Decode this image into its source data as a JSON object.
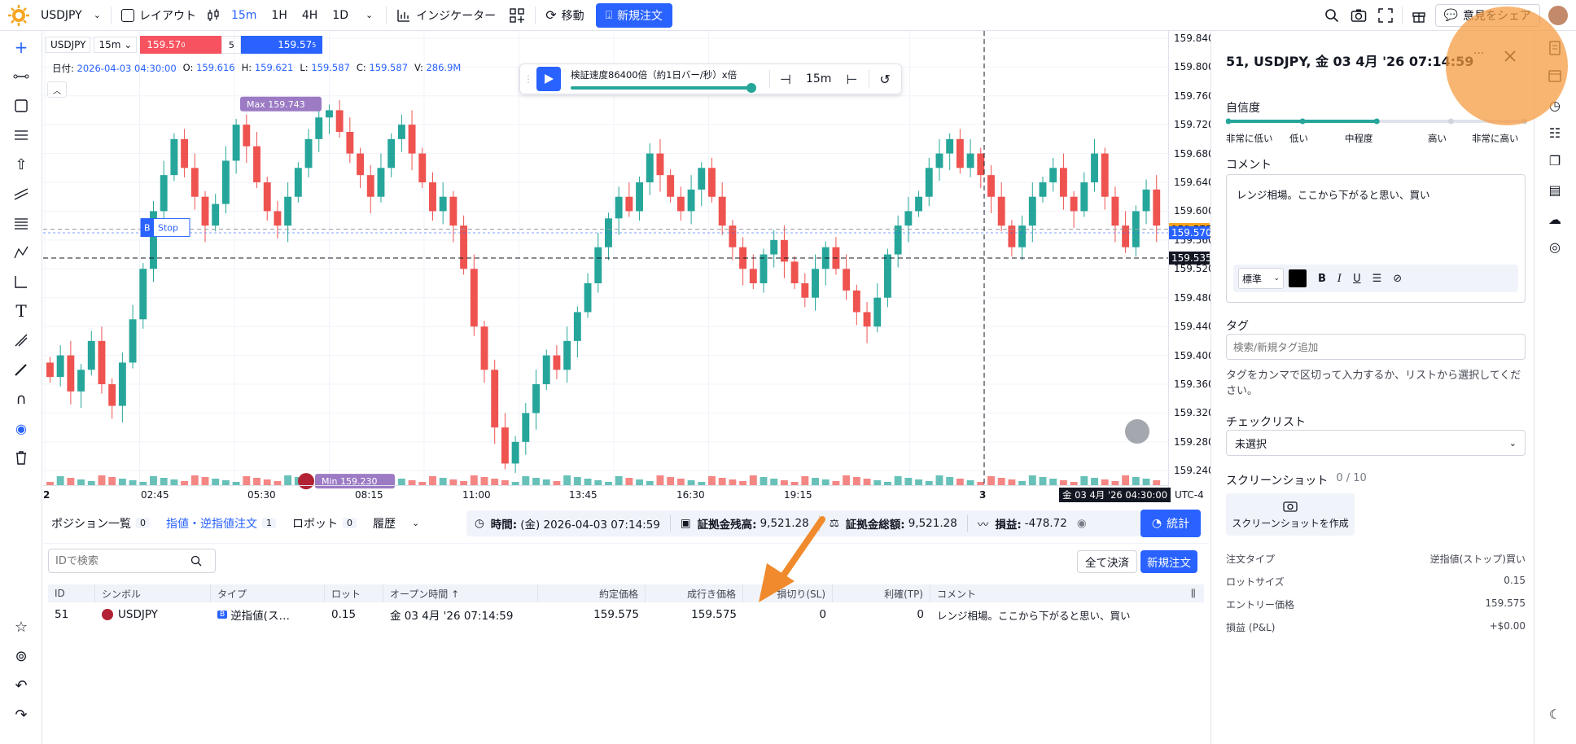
{
  "topbar": {
    "symbol": "USDJPY",
    "layout_label": "レイアウト",
    "timeframes": [
      "15m",
      "1H",
      "4H",
      "1D"
    ],
    "indicators_label": "インジケーター",
    "move_label": "移動",
    "new_order_label": "新規注文",
    "feedback_label": "意見をシェア"
  },
  "legend": {
    "symbol": "USDJPY",
    "interval": "15m",
    "bid": "159.57",
    "bid_sup": "0",
    "spread": "5",
    "ask": "159.57",
    "ask_sup": "5",
    "date_label": "日付:",
    "date": "2026-04-03 04:30:00",
    "o_label": "O:",
    "o": "159.616",
    "h_label": "H:",
    "h": "159.621",
    "l_label": "L:",
    "l": "159.587",
    "c_label": "C:",
    "c": "159.587",
    "v_label": "V:",
    "v": "286.9M"
  },
  "replay": {
    "speed_label": "検証速度86400倍（約1日バー/秒）x倍",
    "interval": "15m",
    "progress": 1.0
  },
  "chart_data": {
    "type": "candlestick",
    "y_ticks": [
      "159.840",
      "159.800",
      "159.760",
      "159.720",
      "159.680",
      "159.640",
      "159.600",
      "159.560",
      "159.520",
      "159.480",
      "159.440",
      "159.400",
      "159.360",
      "159.320",
      "159.280",
      "159.240"
    ],
    "ylim": [
      159.22,
      159.85
    ],
    "x_ticks": [
      "2",
      "02:45",
      "05:30",
      "08:15",
      "11:00",
      "13:45",
      "16:30",
      "19:15",
      "3"
    ],
    "max_label": "Max",
    "max_value": "159.743",
    "min_label": "Min",
    "min_value": "159.230",
    "stop_label": "Stop",
    "stop_side": "B",
    "price_labels": {
      "a": "159.575",
      "b": "159.570",
      "c": "159.535"
    },
    "crosshair_time": "金 03 4月 '26 04:30:00",
    "timezone": "UTC-4",
    "colors": {
      "up": "#26a69a",
      "down": "#ef5350"
    },
    "close_prices": [
      159.37,
      159.4,
      159.35,
      159.38,
      159.42,
      159.36,
      159.33,
      159.39,
      159.45,
      159.52,
      159.6,
      159.65,
      159.7,
      159.66,
      159.62,
      159.58,
      159.61,
      159.67,
      159.72,
      159.69,
      159.64,
      159.6,
      159.58,
      159.62,
      159.66,
      159.7,
      159.73,
      159.74,
      159.71,
      159.68,
      159.65,
      159.62,
      159.66,
      159.7,
      159.72,
      159.68,
      159.64,
      159.6,
      159.62,
      159.58,
      159.52,
      159.44,
      159.38,
      159.3,
      159.25,
      159.28,
      159.32,
      159.36,
      159.4,
      159.38,
      159.42,
      159.46,
      159.5,
      159.55,
      159.59,
      159.62,
      159.6,
      159.64,
      159.68,
      159.65,
      159.62,
      159.6,
      159.63,
      159.66,
      159.62,
      159.58,
      159.55,
      159.52,
      159.5,
      159.54,
      159.56,
      159.53,
      159.5,
      159.48,
      159.52,
      159.55,
      159.52,
      159.49,
      159.46,
      159.44,
      159.48,
      159.54,
      159.58,
      159.6,
      159.62,
      159.66,
      159.68,
      159.7,
      159.66,
      159.68,
      159.65,
      159.62,
      159.58,
      159.55,
      159.58,
      159.62,
      159.64,
      159.66,
      159.62,
      159.6,
      159.64,
      159.68,
      159.62,
      159.58,
      159.55,
      159.6,
      159.63,
      159.58
    ]
  },
  "bottom": {
    "tabs": [
      {
        "label": "ポジション一覧",
        "count": "0"
      },
      {
        "label": "指値・逆指値注文",
        "count": "1"
      },
      {
        "label": "ロボット",
        "count": "0"
      },
      {
        "label": "履歴",
        "count": ""
      }
    ],
    "time_label": "時間:",
    "time_value": "(金) 2026-04-03 07:14:59",
    "balance_label": "証拠金残高:",
    "balance_value": "9,521.28",
    "equity_label": "証拠金総額:",
    "equity_value": "9,521.28",
    "pnl_label": "損益:",
    "pnl_value": "-478.72",
    "stats_label": "統計",
    "search_placeholder": "IDで検索",
    "close_all_label": "全て決済",
    "new_order_label": "新規注文",
    "columns": [
      "ID",
      "シンボル",
      "タイプ",
      "ロット",
      "オープン時間 ↑",
      "約定価格",
      "成行き価格",
      "損切り(SL)",
      "利確(TP)",
      "コメント"
    ],
    "rows": [
      {
        "id": "51",
        "symbol": "USDJPY",
        "type": "逆指値(ス…",
        "lot": "0.15",
        "open_time": "金 03 4月 '26 07:14:59",
        "entry": "159.575",
        "market": "159.575",
        "sl": "0",
        "tp": "0",
        "comment": "レンジ相場。ここから下がると思い、買い"
      }
    ]
  },
  "panel": {
    "title": "51, USDJPY, 金 03 4月 '26 07:14:59",
    "confidence_label": "自信度",
    "confidence_levels": [
      "非常に低い",
      "低い",
      "中程度",
      "高い",
      "非常に高い"
    ],
    "confidence_selected": 2,
    "comment_label": "コメント",
    "comment_text": "レンジ相場。ここから下がると思い、買い",
    "format_label": "標準",
    "tag_label": "タグ",
    "tag_placeholder": "検索/新規タグ追加",
    "tag_hint": "タグをカンマで区切って入力するか、リストから選択してください。",
    "checklist_label": "チェックリスト",
    "checklist_value": "未選択",
    "screenshot_label": "スクリーンショット",
    "screenshot_count": "0 / 10",
    "screenshot_button": "スクリーンショットを作成",
    "details": [
      {
        "k": "注文タイプ",
        "v": "逆指値(ストップ)買い"
      },
      {
        "k": "ロットサイズ",
        "v": "0.15"
      },
      {
        "k": "エントリー価格",
        "v": "159.575"
      },
      {
        "k": "損益 (P&L)",
        "v": "+$0.00"
      }
    ]
  },
  "annotation_colors": {
    "circle": "#f5993c",
    "arrow": "#f08a2c"
  }
}
